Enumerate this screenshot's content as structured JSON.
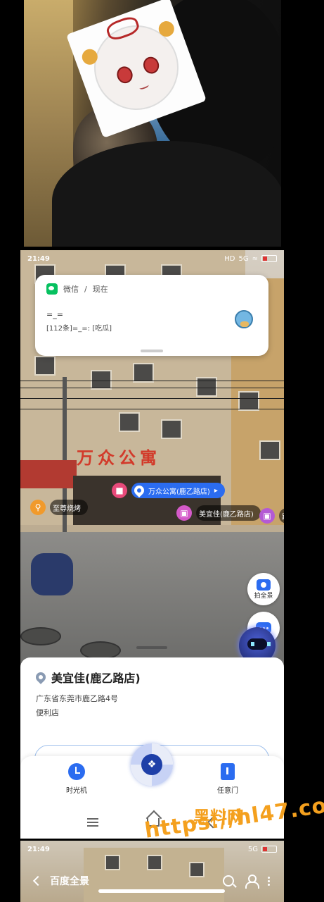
{
  "status_bar": {
    "time": "21:49",
    "network": "5G",
    "hd_label": "HD"
  },
  "notification": {
    "app_name": "微信",
    "separator": "/",
    "time": "现在",
    "sender": "=_=",
    "preview": "[112条]=_=: [吃瓜]"
  },
  "street_view": {
    "store_sign": "万众公寓",
    "poi_labels": [
      {
        "label": "万众公寓(鹿乙路店)",
        "style": "selected"
      },
      {
        "label": "至尊烧烤",
        "style": "dark"
      },
      {
        "label": "美宜佳(鹿乙路店)",
        "style": "dark"
      },
      {
        "label": "路",
        "style": "dark"
      }
    ],
    "capture_button_label": "拍全景"
  },
  "place_card": {
    "name": "美宜佳(鹿乙路店)",
    "address": "广东省东莞市鹿乙路4号",
    "category": "便利店"
  },
  "tab_bar": {
    "items": [
      {
        "label": "时光机",
        "icon": "clock-icon"
      },
      {
        "label": "",
        "icon": "compass-icon"
      },
      {
        "label": "任意门",
        "icon": "door-icon"
      }
    ]
  },
  "panel3": {
    "title": "百度全景"
  },
  "watermark": {
    "title": "黑料网",
    "url": "https://hl47.co"
  },
  "colors": {
    "accent": "#2b6cf0",
    "wechat_green": "#07c160",
    "watermark_orange": "#f4a01e"
  }
}
